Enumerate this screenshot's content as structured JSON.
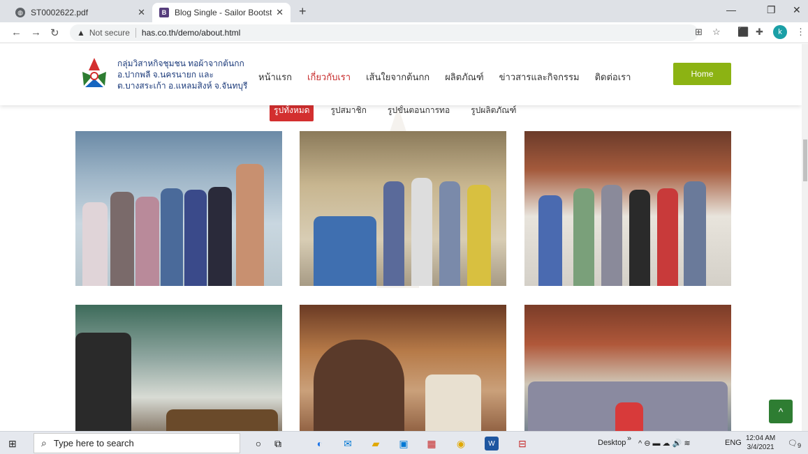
{
  "browser": {
    "tabs": [
      {
        "title": "ST0002622.pdf",
        "icon": "globe-icon"
      },
      {
        "title": "Blog Single - Sailor Bootstrap Te",
        "icon": "bootstrap-icon"
      }
    ],
    "new_tab": "+",
    "url_warning": "Not secure",
    "url": "has.co.th/demo/about.html",
    "profile_initial": "k"
  },
  "site": {
    "brand_lines": [
      "กลุ่มวิสาหกิจชุมชน ทอผ้าจากต้นกก",
      "อ.ปากพลี จ.นครนายก และ",
      "ต.บางสระเก้า อ.แหลมสิงห์ จ.จันทบุรี"
    ],
    "nav": [
      "หน้าแรก",
      "เกี่ยวกับเรา",
      "เส้นใยจากต้นกก",
      "ผลิตภัณฑ์",
      "ข่าวสารและกิจกรรม",
      "ติดต่อเรา"
    ],
    "home_button": "Home",
    "filters": [
      "รูปทั้งหมด",
      "รูปสมาชิก",
      "รูปขั้นตอนการทอ",
      "รูปผลิตภัณฑ์"
    ],
    "to_top": "^"
  },
  "taskbar": {
    "search_placeholder": "Type here to search",
    "desktop_label": "Desktop",
    "language": "ENG",
    "time": "12:04 AM",
    "date": "3/4/2021",
    "notification_count": "9"
  }
}
